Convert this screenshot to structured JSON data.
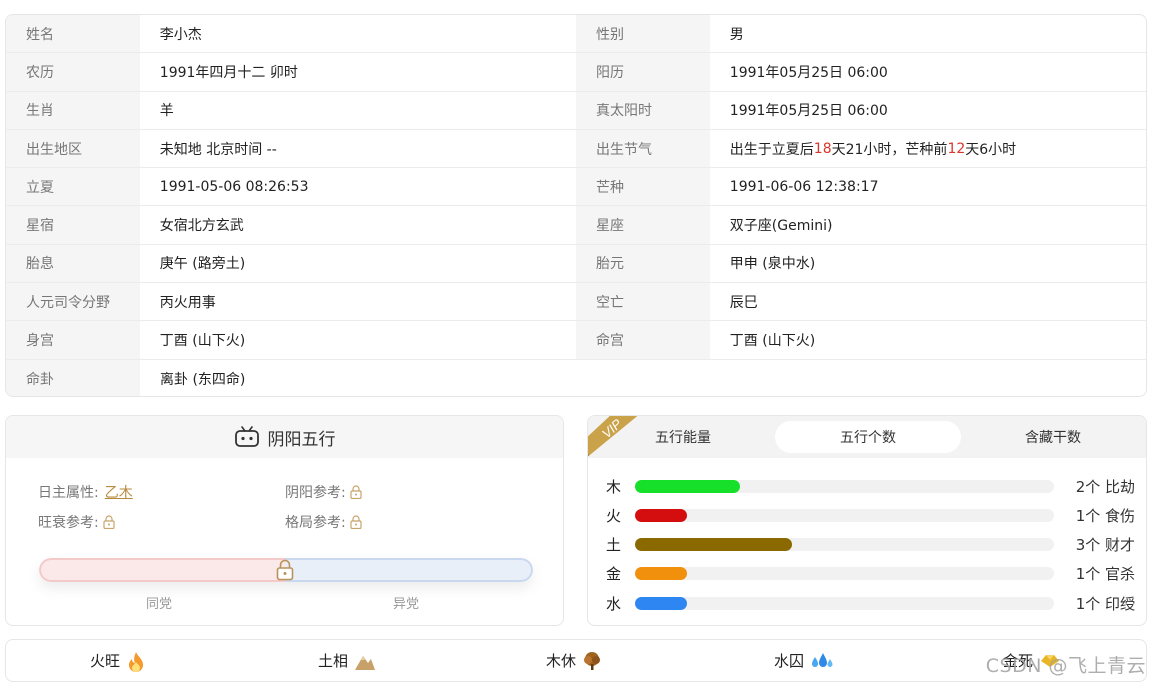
{
  "info": {
    "rows": [
      {
        "l1": "姓名",
        "v1": "李小杰",
        "l2": "性别",
        "v2": "男"
      },
      {
        "l1": "农历",
        "v1": "1991年四月十二 卯时",
        "l2": "阳历",
        "v2": "1991年05月25日 06:00"
      },
      {
        "l1": "生肖",
        "v1": "羊",
        "l2": "真太阳时",
        "v2": "1991年05月25日 06:00"
      },
      {
        "l1": "出生地区",
        "v1": "未知地 北京时间 --",
        "l2": "出生节气",
        "v2_a": "出生于立夏后",
        "v2_b": "18",
        "v2_c": "天21小时，芒种前",
        "v2_d": "12",
        "v2_e": "天6小时"
      },
      {
        "l1": "立夏",
        "v1": "1991-05-06 08:26:53",
        "l2": "芒种",
        "v2": "1991-06-06 12:38:17"
      },
      {
        "l1": "星宿",
        "v1": "女宿北方玄武",
        "l2": "星座",
        "v2": "双子座(Gemini)"
      },
      {
        "l1": "胎息",
        "v1": "庚午 (路旁土)",
        "l2": "胎元",
        "v2": "甲申 (泉中水)"
      },
      {
        "l1": "人元司令分野",
        "v1": "丙火用事",
        "l2": "空亡",
        "v2": "辰巳"
      },
      {
        "l1": "身宫",
        "v1": "丁酉 (山下火)",
        "l2": "命宫",
        "v2": "丁酉 (山下火)"
      },
      {
        "l1": "命卦",
        "v1": "离卦 (东四命)"
      }
    ]
  },
  "yinyang": {
    "title": "阴阳五行",
    "rizhu_label": "日主属性:",
    "rizhu_value": "乙木",
    "yinyang_label": "阴阳参考:",
    "wangshuai_label": "旺衰参考:",
    "geju_label": "格局参考:",
    "left_caption": "同党",
    "right_caption": "异党"
  },
  "wuxing": {
    "vip": "VIP",
    "tabs": [
      "五行能量",
      "五行个数",
      "含藏干数"
    ],
    "active_tab": 1,
    "rows": [
      {
        "name": "木",
        "value": 2,
        "count": "2个 比劫",
        "color": "#16e02a"
      },
      {
        "name": "火",
        "value": 1,
        "count": "1个 食伤",
        "color": "#d40e0e"
      },
      {
        "name": "土",
        "value": 3,
        "count": "3个 财才",
        "color": "#8a6a00"
      },
      {
        "name": "金",
        "value": 1,
        "count": "1个 官杀",
        "color": "#f0900c"
      },
      {
        "name": "水",
        "value": 1,
        "count": "1个 印绶",
        "color": "#2e86f2"
      }
    ],
    "max_value": 8
  },
  "status": [
    {
      "label": "火旺",
      "icon": "flame-icon"
    },
    {
      "label": "土相",
      "icon": "mountain-icon"
    },
    {
      "label": "木休",
      "icon": "tree-icon"
    },
    {
      "label": "水囚",
      "icon": "water-drops-icon"
    },
    {
      "label": "金死",
      "icon": "gold-ingot-icon"
    }
  ],
  "watermark": "CSDN @飞上青云"
}
